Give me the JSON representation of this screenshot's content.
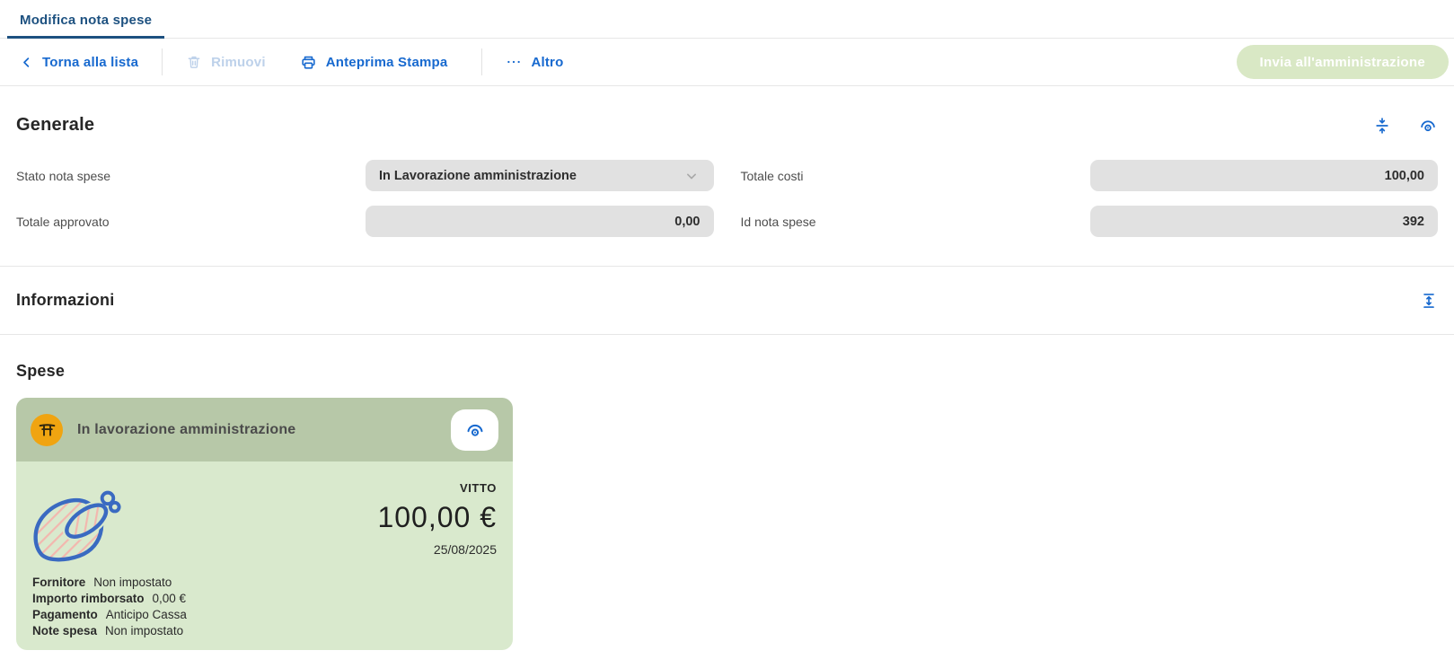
{
  "tab": {
    "label": "Modifica nota spese"
  },
  "toolbar": {
    "back_label": "Torna alla lista",
    "remove_label": "Rimuovi",
    "print_label": "Anteprima Stampa",
    "more_label": "Altro",
    "submit_label": "Invia all'amministrazione"
  },
  "generale": {
    "title": "Generale",
    "stato": {
      "label": "Stato nota spese",
      "value": "In Lavorazione amministrazione"
    },
    "totale_costi": {
      "label": "Totale costi",
      "value": "100,00"
    },
    "totale_approvato": {
      "label": "Totale approvato",
      "value": "0,00"
    },
    "id_nota_spese": {
      "label": "Id nota spese",
      "value": "392"
    }
  },
  "informazioni": {
    "title": "Informazioni"
  },
  "spese": {
    "title": "Spese",
    "card": {
      "status": "In lavorazione amministrazione",
      "category": "VITTO",
      "amount": "100,00 €",
      "date": "25/08/2025",
      "details": [
        {
          "label": "Fornitore",
          "value": "Non impostato"
        },
        {
          "label": "Importo rimborsato",
          "value": "0,00 €"
        },
        {
          "label": "Pagamento",
          "value": "Anticipo Cassa"
        },
        {
          "label": "Note spesa",
          "value": "Non impostato"
        }
      ]
    }
  },
  "icons": {
    "back": "chevron-left-icon",
    "remove": "trash-icon",
    "print": "printer-icon",
    "more": "ellipsis-icon",
    "collapse": "collapse-vertical-icon",
    "preview": "eye-icon",
    "expand": "expand-vertical-icon",
    "category_badge": "food-table-icon",
    "dropdown": "chevron-down-icon",
    "illustration": "turkey-illustration"
  },
  "colors": {
    "navy": "#1d5180",
    "accent_blue": "#1769cf",
    "disabled_blue": "#bdd1ea",
    "submit_green": "#d9e8c5",
    "card_header_green": "#b7c8a8",
    "card_body_green": "#d9e9cd",
    "orange": "#f0a411",
    "field_gray": "#e1e1e1",
    "turkey_blue": "#3a6ac1",
    "stripe_pink": "#f3b7ae"
  }
}
